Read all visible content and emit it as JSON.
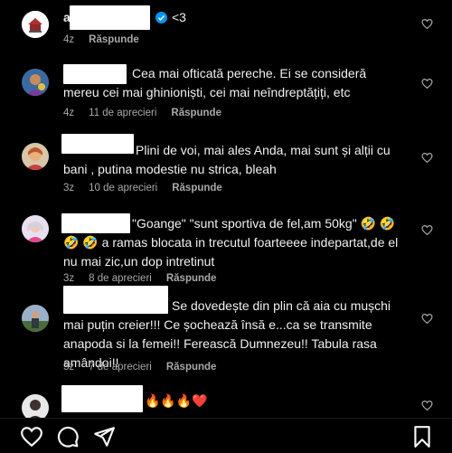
{
  "comments": [
    {
      "text": "<3",
      "verified": true,
      "time": "4z",
      "likes": "",
      "reply": "Răspunde"
    },
    {
      "text": "Cea mai ofticată pereche. Ei se consideră mereu cei mai ghinioniști, cei mai neîndreptățiți, etc",
      "time": "4z",
      "likes": "11 de aprecieri",
      "reply": "Răspunde"
    },
    {
      "text": "Plini de voi, mai ales Anda, mai sunt și alții cu bani , putina modestie nu strica, bleah",
      "time": "3z",
      "likes": "10 de aprecieri",
      "reply": "Răspunde"
    },
    {
      "text": "\"Goange\" \"sunt sportiva de fel,am 50kg\" 🤣 🤣 🤣 🤣 a ramas blocata in trecutul foarteeee indepartat,de el nu mai zic,un dop intretinut",
      "time": "3z",
      "likes": "8 de aprecieri",
      "reply": "Răspunde"
    },
    {
      "text": "Se dovedește din plin că aia cu mușchi mai puțin creier!!! Ce șochează însă e...ca se transmite anapoda si la femei!! Ferească Dumnezeu!! Tabula rasa amândoi!!",
      "time": "3z",
      "likes": "7 de aprecieri",
      "reply": "Răspunde"
    },
    {
      "text": "🔥🔥🔥❤️"
    }
  ],
  "first_username_initial": "a",
  "icons": {
    "heart": "heart-outline-icon",
    "verified": "verified-badge-icon",
    "like": "heart-icon",
    "comment": "comment-icon",
    "share": "send-icon",
    "save": "bookmark-icon"
  },
  "colors": {
    "background": "#000000",
    "text": "#f5f5f5",
    "meta": "#a8a8a8",
    "verified": "#0095f6"
  }
}
